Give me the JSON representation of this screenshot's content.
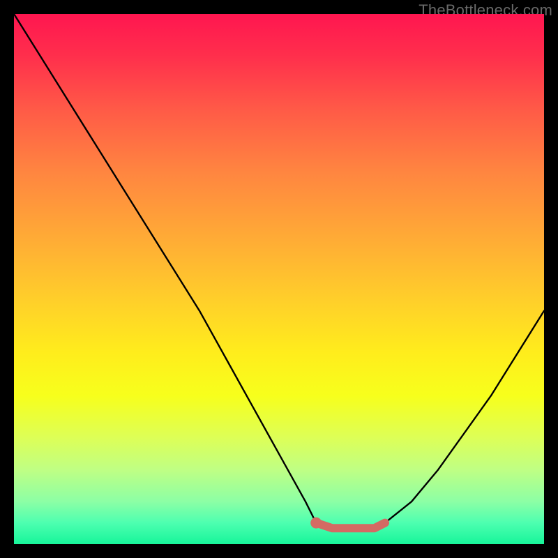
{
  "watermark": "TheBottleneck.com",
  "colors": {
    "background": "#000000",
    "curve": "#000000",
    "highlight": "#d46a63",
    "gradient_top": "#ff1650",
    "gradient_bottom": "#17f59a"
  },
  "chart_data": {
    "type": "line",
    "title": "",
    "xlabel": "",
    "ylabel": "",
    "x": [
      0,
      5,
      10,
      15,
      20,
      25,
      30,
      35,
      40,
      45,
      50,
      55,
      57,
      60,
      65,
      68,
      70,
      75,
      80,
      85,
      90,
      95,
      100
    ],
    "values": [
      100,
      92,
      84,
      76,
      68,
      60,
      52,
      44,
      35,
      26,
      17,
      8,
      4,
      3,
      3,
      3,
      4,
      8,
      14,
      21,
      28,
      36,
      44
    ],
    "ylim": [
      0,
      100
    ],
    "xlim": [
      0,
      100
    ],
    "legend": "",
    "highlight_range": {
      "x_start": 57,
      "x_end": 70,
      "note": "minimum plateau tinted"
    }
  }
}
